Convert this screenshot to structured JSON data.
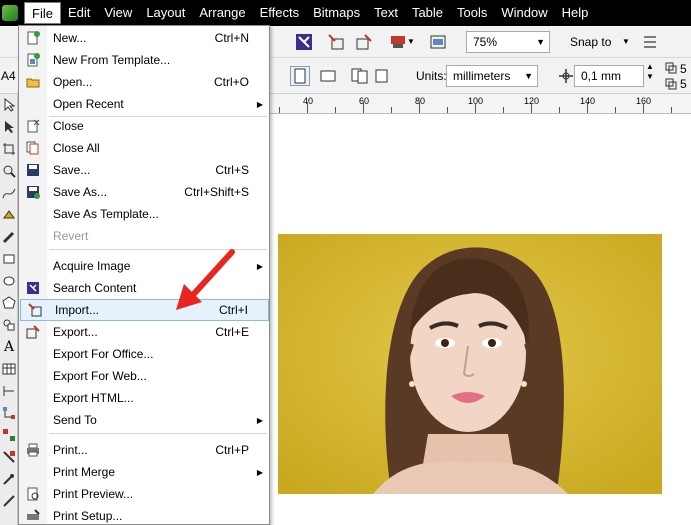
{
  "menubar": {
    "items": [
      "File",
      "Edit",
      "View",
      "Layout",
      "Arrange",
      "Effects",
      "Bitmaps",
      "Text",
      "Table",
      "Tools",
      "Window",
      "Help"
    ],
    "active": "File"
  },
  "toolbar": {
    "zoom": "75%",
    "snap_label": "Snap to",
    "paper_label": "A4",
    "units_label": "Units:",
    "units_value": "millimeters",
    "nudge_value": "0,1 mm",
    "dup_x": "5",
    "dup_y": "5"
  },
  "ruler": {
    "labels": [
      "40",
      "60",
      "80",
      "100",
      "120",
      "140",
      "160"
    ]
  },
  "file_menu": {
    "items": [
      {
        "label": "New...",
        "shortcut": "Ctrl+N",
        "icon": "new-doc-icon"
      },
      {
        "label": "New From Template...",
        "shortcut": "",
        "icon": "template-icon"
      },
      {
        "label": "Open...",
        "shortcut": "Ctrl+O",
        "icon": "open-folder-icon"
      },
      {
        "label": "Open Recent",
        "shortcut": "",
        "icon": "",
        "submenu": true
      },
      {
        "label": "Close",
        "shortcut": "",
        "icon": "close-doc-icon"
      },
      {
        "label": "Close All",
        "shortcut": "",
        "icon": "close-all-icon"
      },
      {
        "label": "Save...",
        "shortcut": "Ctrl+S",
        "icon": "save-icon"
      },
      {
        "label": "Save As...",
        "shortcut": "Ctrl+Shift+S",
        "icon": "save-as-icon"
      },
      {
        "label": "Save As Template...",
        "shortcut": "",
        "icon": ""
      },
      {
        "label": "Revert",
        "shortcut": "",
        "icon": "",
        "disabled": true
      },
      {
        "label": "Acquire Image",
        "shortcut": "",
        "icon": "",
        "submenu": true
      },
      {
        "label": "Search Content",
        "shortcut": "",
        "icon": "search-content-icon"
      },
      {
        "label": "Import...",
        "shortcut": "Ctrl+I",
        "icon": "import-icon",
        "highlighted": true
      },
      {
        "label": "Export...",
        "shortcut": "Ctrl+E",
        "icon": "export-icon"
      },
      {
        "label": "Export For Office...",
        "shortcut": "",
        "icon": ""
      },
      {
        "label": "Export For Web...",
        "shortcut": "",
        "icon": ""
      },
      {
        "label": "Export HTML...",
        "shortcut": "",
        "icon": ""
      },
      {
        "label": "Send To",
        "shortcut": "",
        "icon": "",
        "submenu": true
      },
      {
        "label": "Print...",
        "shortcut": "Ctrl+P",
        "icon": "print-icon"
      },
      {
        "label": "Print Merge",
        "shortcut": "",
        "icon": "",
        "submenu": true
      },
      {
        "label": "Print Preview...",
        "shortcut": "",
        "icon": "print-preview-icon"
      },
      {
        "label": "Print Setup...",
        "shortcut": "",
        "icon": "print-setup-icon"
      }
    ]
  },
  "colors": {
    "menubar_bg": "#000000",
    "photo_bg": "#d4b52a",
    "arrow": "#e8251f",
    "highlight": "#e5f1fb"
  }
}
